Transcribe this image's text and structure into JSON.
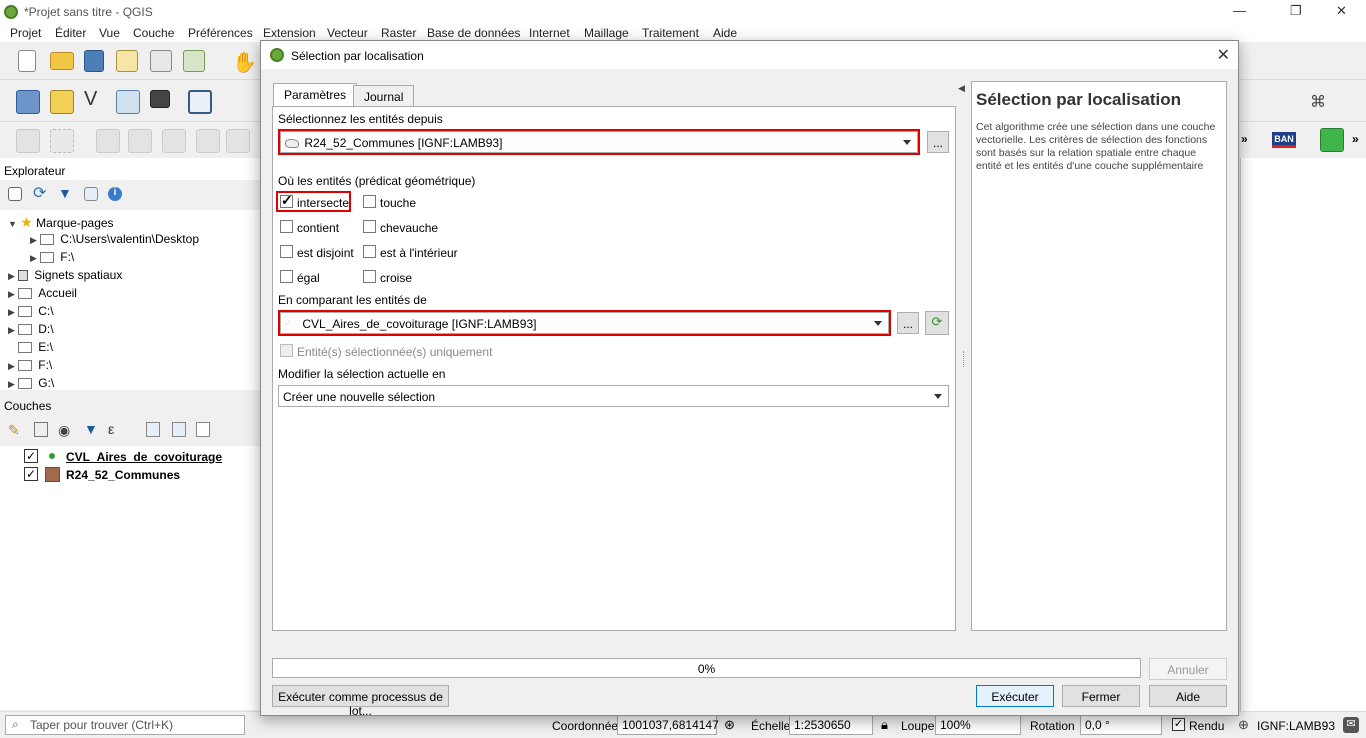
{
  "window": {
    "title": "*Projet sans titre - QGIS",
    "controls": {
      "minimize": "—",
      "restore": "❐",
      "close": "✕"
    }
  },
  "menu": [
    "Projet",
    "Éditer",
    "Vue",
    "Couche",
    "Préférences",
    "Extension",
    "Vecteur",
    "Raster",
    "Base de données",
    "Internet",
    "Maillage",
    "Traitement",
    "Aide"
  ],
  "explorer": {
    "title": "Explorateur",
    "items": [
      {
        "label": "Marque-pages",
        "indent": 0,
        "icon": "star-icon"
      },
      {
        "label": "C:\\Users\\valentin\\Desktop",
        "indent": 1,
        "icon": "folder-icon"
      },
      {
        "label": "F:\\",
        "indent": 1,
        "icon": "folder-icon"
      },
      {
        "label": "Signets spatiaux",
        "indent": 0,
        "icon": "bookmark-icon"
      },
      {
        "label": "Accueil",
        "indent": 0,
        "icon": "folder-icon"
      },
      {
        "label": "C:\\",
        "indent": 0,
        "icon": "drive-icon"
      },
      {
        "label": "D:\\",
        "indent": 0,
        "icon": "drive-icon"
      },
      {
        "label": "E:\\",
        "indent": 0,
        "icon": "drive-icon"
      },
      {
        "label": "F:\\",
        "indent": 0,
        "icon": "drive-icon"
      },
      {
        "label": "G:\\",
        "indent": 0,
        "icon": "drive-icon"
      }
    ]
  },
  "layers": {
    "title": "Couches",
    "items": [
      {
        "label": "CVL_Aires_de_covoiturage",
        "checked": true,
        "bold": true,
        "underline": true,
        "symbol": "point",
        "color": "#2fa12f"
      },
      {
        "label": "R24_52_Communes",
        "checked": true,
        "bold": true,
        "symbol": "polygon",
        "color": "#a06a4f"
      }
    ]
  },
  "dialog": {
    "title": "Sélection par localisation",
    "tabs": [
      "Paramètres",
      "Journal"
    ],
    "select_from_label": "Sélectionnez les entités depuis",
    "select_from_value": "R24_52_Communes [IGNF:LAMB93]",
    "predicate_label": "Où les entités (prédicat géométrique)",
    "predicates": [
      {
        "label": "intersecte",
        "checked": true
      },
      {
        "label": "touche",
        "checked": false
      },
      {
        "label": "contient",
        "checked": false
      },
      {
        "label": "chevauche",
        "checked": false
      },
      {
        "label": "est disjoint",
        "checked": false
      },
      {
        "label": "est à l'intérieur",
        "checked": false
      },
      {
        "label": "égal",
        "checked": false
      },
      {
        "label": "croise",
        "checked": false
      }
    ],
    "compare_label": "En comparant les entités de",
    "compare_value": "CVL_Aires_de_covoiturage [IGNF:LAMB93]",
    "selected_only_label": "Entité(s) sélectionnée(s) uniquement",
    "modify_label": "Modifier la sélection actuelle en",
    "modify_value": "Créer une nouvelle sélection",
    "browse_label": "...",
    "help_title": "Sélection par localisation",
    "help_text": "Cet algorithme crée une sélection dans une couche vectorielle. Les critères de sélection des fonctions sont basés sur la relation spatiale entre chaque entité et les entités d'une couche supplémentaire",
    "progress_percent": 0,
    "progress_text": "0%",
    "cancel_label": "Annuler",
    "batch_label": "Exécuter comme processus de lot...",
    "run_label": "Exécuter",
    "close_label": "Fermer",
    "help_label": "Aide"
  },
  "statusbar": {
    "search_placeholder": "Taper pour trouver (Ctrl+K)",
    "coord_label": "Coordonnée",
    "coord_value": "1001037,6814147",
    "scale_label": "Échelle",
    "scale_value": "1:2530650",
    "zoom_label": "Loupe",
    "zoom_value": "100%",
    "rotation_label": "Rotation",
    "rotation_value": "0,0 °",
    "render_label": "Rendu",
    "crs": "IGNF:LAMB93"
  },
  "toolbar_extra": {
    "ban_label": "BAN"
  }
}
